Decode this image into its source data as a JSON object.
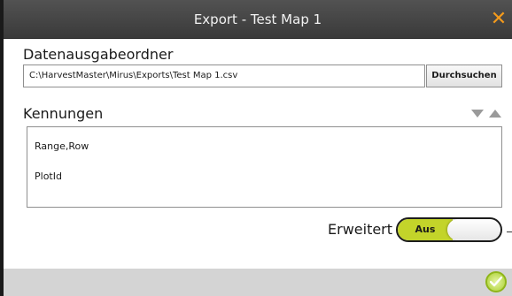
{
  "window": {
    "title": "Export - Test Map 1",
    "close_icon": "close-icon",
    "close_color": "#f39a1c"
  },
  "output_folder": {
    "label": "Datenausgabeordner",
    "path": "C:\\HarvestMaster\\Mirus\\Exports\\Test Map 1.csv",
    "browse_label": "Durchsuchen"
  },
  "identifiers": {
    "label": "Kennungen",
    "items": [
      "Range,Row",
      "PlotId"
    ],
    "move_down_icon": "triangle-down-icon",
    "move_up_icon": "triangle-up-icon"
  },
  "advanced": {
    "label": "Erweitert",
    "toggle_state": "Aus",
    "toggle_color": "#c3d42a"
  },
  "footer": {
    "confirm_icon": "check-circle-icon",
    "confirm_color": "#a9cf2d"
  }
}
